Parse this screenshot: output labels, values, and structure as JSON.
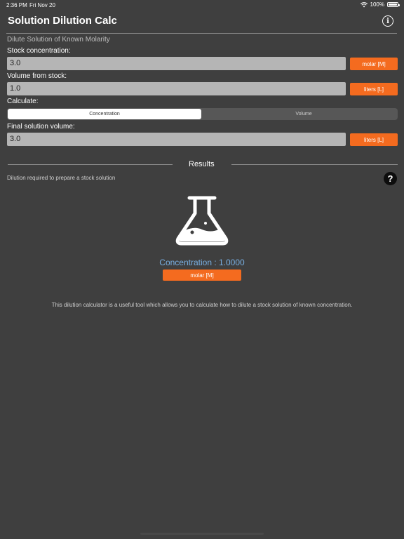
{
  "status_bar": {
    "time": "2:36 PM",
    "date": "Fri Nov 20",
    "battery": "100%",
    "icons": [
      "wifi-icon",
      "battery-icon"
    ]
  },
  "nav": {
    "title": "Solution Dilution Calc",
    "info_glyph": "i"
  },
  "form": {
    "heading": "Dilute Solution of Known Molarity",
    "stock_concentration": {
      "label": "Stock concentration:",
      "value": "3.0",
      "unit": "molar [M]"
    },
    "volume_from_stock": {
      "label": "Volume from stock:",
      "value": "1.0",
      "unit": "liters [L]"
    },
    "calculate": {
      "label": "Calculate:",
      "options": [
        "Concentration",
        "Volume"
      ],
      "selected": "Concentration"
    },
    "final_volume": {
      "label": "Final solution volume:",
      "value": "3.0",
      "unit": "liters [L]"
    }
  },
  "results": {
    "title": "Results",
    "subtitle": "Dilution required to prepare a stock solution",
    "help_glyph": "?",
    "value_text": "Concentration : 1.0000",
    "unit": "molar [M]",
    "description": "This dilution calculator is a useful tool which allows you to calculate how to dilute a stock solution of known concentration."
  },
  "colors": {
    "background": "#3f3f3f",
    "accent": "#f46b1f",
    "result_text": "#78aee0",
    "input_bg": "#b5b5b5"
  }
}
